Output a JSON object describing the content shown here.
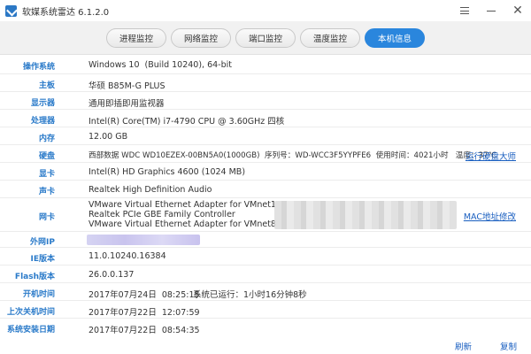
{
  "window": {
    "title": "软媒系统雷达 6.1.2.0"
  },
  "tabs": [
    {
      "label": "进程监控",
      "active": false
    },
    {
      "label": "网络监控",
      "active": false
    },
    {
      "label": "端口监控",
      "active": false
    },
    {
      "label": "温度监控",
      "active": false
    },
    {
      "label": "本机信息",
      "active": true
    }
  ],
  "rows": {
    "os": {
      "label": "操作系统",
      "value": "Windows 10  (Build 10240), 64-bit"
    },
    "board": {
      "label": "主板",
      "value": "华硕 B85M-G PLUS"
    },
    "display": {
      "label": "显示器",
      "value": "通用即插即用监视器"
    },
    "cpu": {
      "label": "处理器",
      "value": "Intel(R) Core(TM) i7-4790 CPU @ 3.60GHz 四核"
    },
    "memory": {
      "label": "内存",
      "value": "12.00 GB"
    },
    "disk": {
      "label": "硬盘",
      "value": "西部数据 WDC WD10EZEX-00BN5A0(1000GB)  序列号：WD-WCC3F5YYPFE6  使用时间：4021小时   温度：37℃",
      "link": "运行硬盘大师"
    },
    "gpu": {
      "label": "显卡",
      "value": "Intel(R) HD Graphics 4600 (1024 MB)"
    },
    "sound": {
      "label": "声卡",
      "value": "Realtek High Definition Audio"
    },
    "nic": {
      "label": "网卡",
      "values": [
        "VMware Virtual Ethernet Adapter for VMnet1",
        "Realtek PCIe GBE Family Controller",
        "VMware Virtual Ethernet Adapter for VMnet8"
      ],
      "link": "MAC地址修改"
    },
    "ip": {
      "label": "外网IP",
      "value": ""
    },
    "ie": {
      "label": "IE版本",
      "value": "11.0.10240.16384"
    },
    "flash": {
      "label": "Flash版本",
      "value": "26.0.0.137"
    },
    "boot": {
      "label": "开机时间",
      "value": "2017年07月24日  08:25:15",
      "extra": "系统已运行：1小时16分钟8秒"
    },
    "shutdown": {
      "label": "上次关机时间",
      "value": "2017年07月22日  12:07:59"
    },
    "install": {
      "label": "系统安装日期",
      "value": "2017年07月22日  08:54:35"
    }
  },
  "footer": {
    "refresh_label": "刷新",
    "copy_label": "复制"
  },
  "colors": {
    "accent": "#2a86dd",
    "label": "#2a7ac9",
    "link": "#1a5fc0"
  }
}
